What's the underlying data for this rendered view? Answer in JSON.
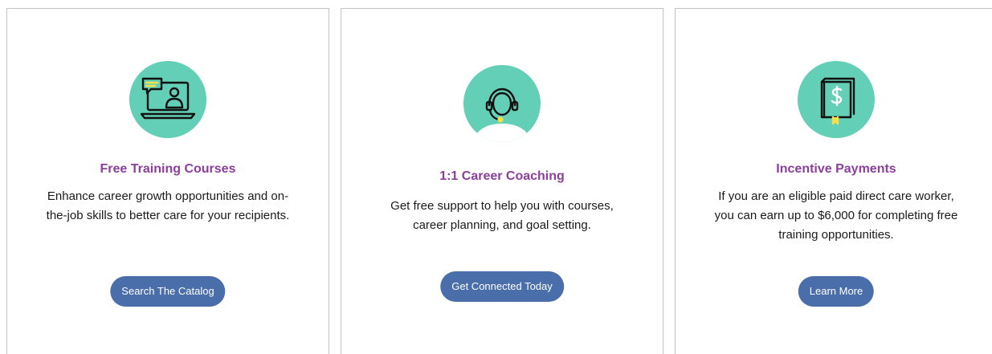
{
  "colors": {
    "accent_teal": "#63cfb6",
    "title_purple": "#8a3f9c",
    "button_blue": "#4a6ea9",
    "highlight_yellow": "#f5e04a"
  },
  "cards": [
    {
      "icon": "laptop-video-chat-icon",
      "title": "Free Training Courses",
      "description": "Enhance career growth opportunities and on-the-job skills to better care for your recipients.",
      "button_label": "Search The Catalog"
    },
    {
      "icon": "headset-support-icon",
      "title": "1:1 Career Coaching",
      "description": "Get free support to help you with courses, career planning, and goal setting.",
      "button_label": "Get Connected Today"
    },
    {
      "icon": "dollar-book-icon",
      "title": "Incentive Payments",
      "description": "If you are an eligible paid direct care worker, you can earn up to $6,000 for completing free training opportunities.",
      "button_label": "Learn More"
    }
  ]
}
